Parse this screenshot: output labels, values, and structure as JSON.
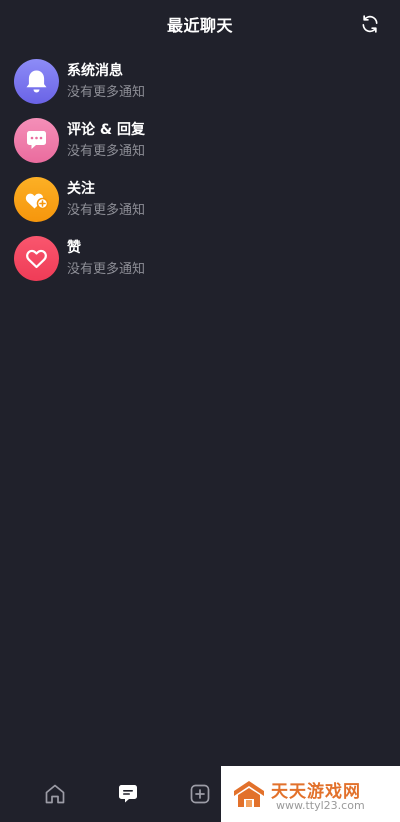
{
  "header": {
    "title": "最近聊天"
  },
  "conversations": [
    {
      "title": "系统消息",
      "subtitle": "没有更多通知",
      "icon": "bell-icon",
      "color_top": "#8d8cf7",
      "color_bottom": "#6a63e6"
    },
    {
      "title": "评论 & 回复",
      "subtitle": "没有更多通知",
      "icon": "comment-icon",
      "color_top": "#f48fb8",
      "color_bottom": "#ea6c9e"
    },
    {
      "title": "关注",
      "subtitle": "没有更多通知",
      "icon": "heart-plus-icon",
      "color_top": "#fcb025",
      "color_bottom": "#f6960c"
    },
    {
      "title": "赞",
      "subtitle": "没有更多通知",
      "icon": "heart-icon",
      "color_top": "#f9566e",
      "color_bottom": "#ef3c57"
    }
  ],
  "tabbar": {
    "tabs": [
      {
        "name": "home",
        "icon": "home-icon",
        "active": false
      },
      {
        "name": "messages",
        "icon": "message-icon",
        "active": true
      },
      {
        "name": "create",
        "icon": "plus-square-icon",
        "active": false
      }
    ]
  },
  "watermark": {
    "name": "天天游戏网",
    "url": "www.ttyl23.com"
  },
  "colors": {
    "background": "#20212b",
    "text_primary": "#ffffff",
    "text_secondary": "#8d8e96",
    "watermark_orange": "#e2712b"
  }
}
